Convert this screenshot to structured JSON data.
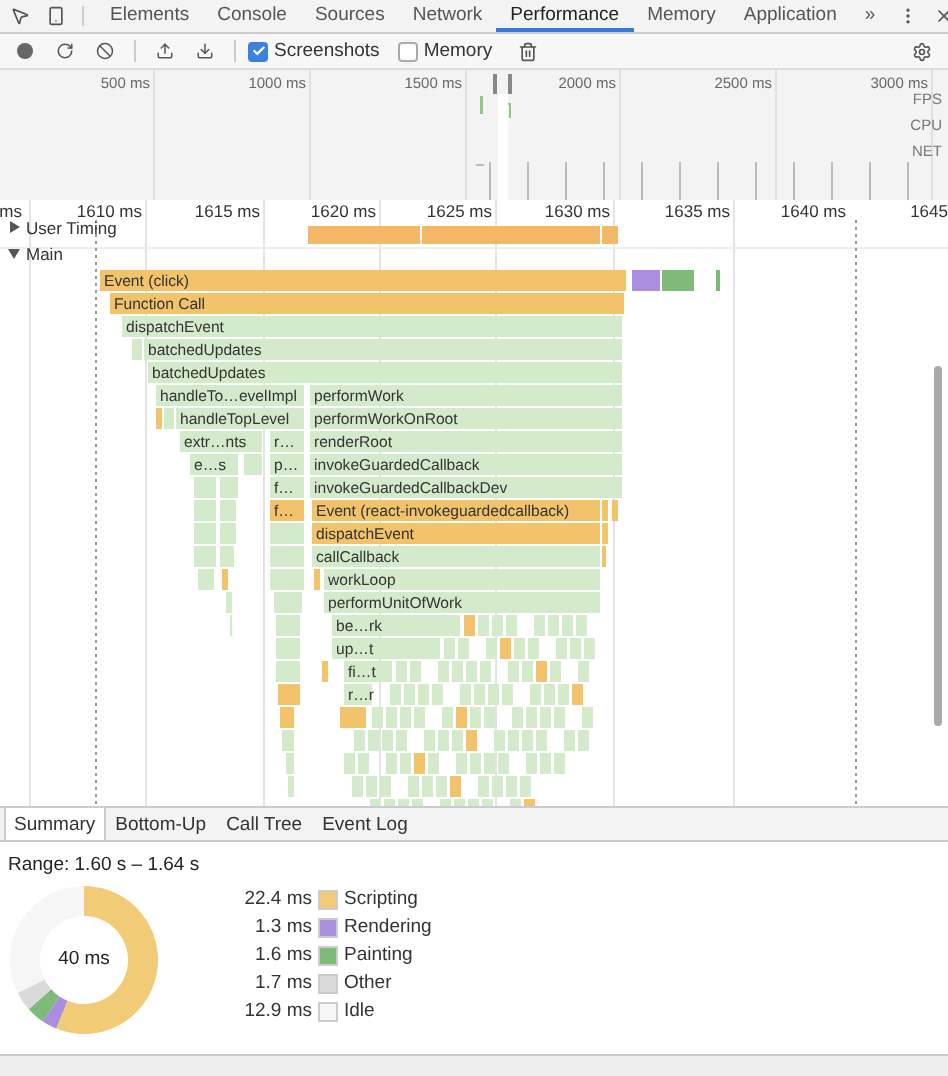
{
  "devtools_tabs": [
    {
      "label": "Elements",
      "selected": false
    },
    {
      "label": "Console",
      "selected": false
    },
    {
      "label": "Sources",
      "selected": false
    },
    {
      "label": "Network",
      "selected": false
    },
    {
      "label": "Performance",
      "selected": true
    },
    {
      "label": "Memory",
      "selected": false
    },
    {
      "label": "Application",
      "selected": false
    }
  ],
  "more_tabs": "»",
  "toolbar": {
    "checkboxes": [
      {
        "label": "Screenshots",
        "checked": true
      },
      {
        "label": "Memory",
        "checked": false
      }
    ]
  },
  "overview": {
    "ticks": [
      "500 ms",
      "1000 ms",
      "1500 ms",
      "2000 ms",
      "2500 ms",
      "3000 ms"
    ],
    "tracks": [
      "FPS",
      "CPU",
      "NET"
    ]
  },
  "timeline": {
    "ticks": [
      "ms",
      "1610 ms",
      "1615 ms",
      "1620 ms",
      "1625 ms",
      "1630 ms",
      "1635 ms",
      "1640 ms",
      "1645"
    ],
    "tracks": [
      {
        "label": "User Timing",
        "expanded": false
      },
      {
        "label": "Main",
        "expanded": true
      }
    ],
    "flame_rows": [
      [
        {
          "label": "Event (click)",
          "color": "#f3c36c"
        }
      ],
      [
        {
          "label": "Function Call",
          "color": "#f3c36c"
        }
      ],
      [
        {
          "label": "dispatchEvent",
          "color": "#d4ebcb"
        }
      ],
      [
        {
          "label": "batchedUpdates",
          "color": "#d4ebcb"
        }
      ],
      [
        {
          "label": "batchedUpdates",
          "color": "#d4ebcb"
        }
      ],
      [
        {
          "label": "handleTo…evelImpl",
          "color": "#d4ebcb"
        },
        {
          "label": "performWork",
          "color": "#d4ebcb"
        }
      ],
      [
        {
          "label": "handleTopLevel",
          "color": "#d4ebcb"
        },
        {
          "label": "performWorkOnRoot",
          "color": "#d4ebcb"
        }
      ],
      [
        {
          "label": "extr…nts",
          "color": "#d4ebcb"
        },
        {
          "label": "r…",
          "color": "#d4ebcb"
        },
        {
          "label": "renderRoot",
          "color": "#d4ebcb"
        }
      ],
      [
        {
          "label": "e…s",
          "color": "#d4ebcb"
        },
        {
          "label": "p…",
          "color": "#d4ebcb"
        },
        {
          "label": "invokeGuardedCallback",
          "color": "#d4ebcb"
        }
      ],
      [
        {
          "label": "f…",
          "color": "#d4ebcb"
        },
        {
          "label": "invokeGuardedCallbackDev",
          "color": "#d4ebcb"
        }
      ],
      [
        {
          "label": "f…",
          "color": "#f3c36c"
        },
        {
          "label": "Event (react-invokeguardedcallback)",
          "color": "#f3c36c"
        }
      ],
      [
        {
          "label": "dispatchEvent",
          "color": "#f3c36c"
        }
      ],
      [
        {
          "label": "callCallback",
          "color": "#d4ebcb"
        }
      ],
      [
        {
          "label": "workLoop",
          "color": "#d4ebcb"
        }
      ],
      [
        {
          "label": "performUnitOfWork",
          "color": "#d4ebcb"
        }
      ],
      [
        {
          "label": "be…rk",
          "color": "#d4ebcb"
        }
      ],
      [
        {
          "label": "up…t",
          "color": "#d4ebcb"
        }
      ],
      [
        {
          "label": "fi…t",
          "color": "#d4ebcb"
        }
      ],
      [
        {
          "label": "r…r",
          "color": "#d4ebcb"
        }
      ]
    ]
  },
  "details": {
    "tabs": [
      {
        "label": "Summary",
        "selected": true
      },
      {
        "label": "Bottom-Up",
        "selected": false
      },
      {
        "label": "Call Tree",
        "selected": false
      },
      {
        "label": "Event Log",
        "selected": false
      }
    ],
    "range": "Range: 1.60 s – 1.64 s",
    "total": "40 ms",
    "legend": [
      {
        "value": "22.4 ms",
        "color": "#f2cb77"
      },
      {
        "value": "1.3 ms",
        "color": "#a98ee0"
      },
      {
        "value": "1.6 ms",
        "color": "#80ba78"
      },
      {
        "value": "1.7 ms",
        "color": "#dadada"
      },
      {
        "value": "12.9 ms",
        "color": "#f6f6f6"
      }
    ],
    "chart_data": {
      "type": "donut",
      "categories": [
        "Scripting",
        "Rendering",
        "Painting",
        "Other",
        "Idle"
      ],
      "series": [
        {
          "values": [
            56.14,
            3.26,
            4.01,
            4.26,
            32.33
          ]
        }
      ]
    }
  }
}
